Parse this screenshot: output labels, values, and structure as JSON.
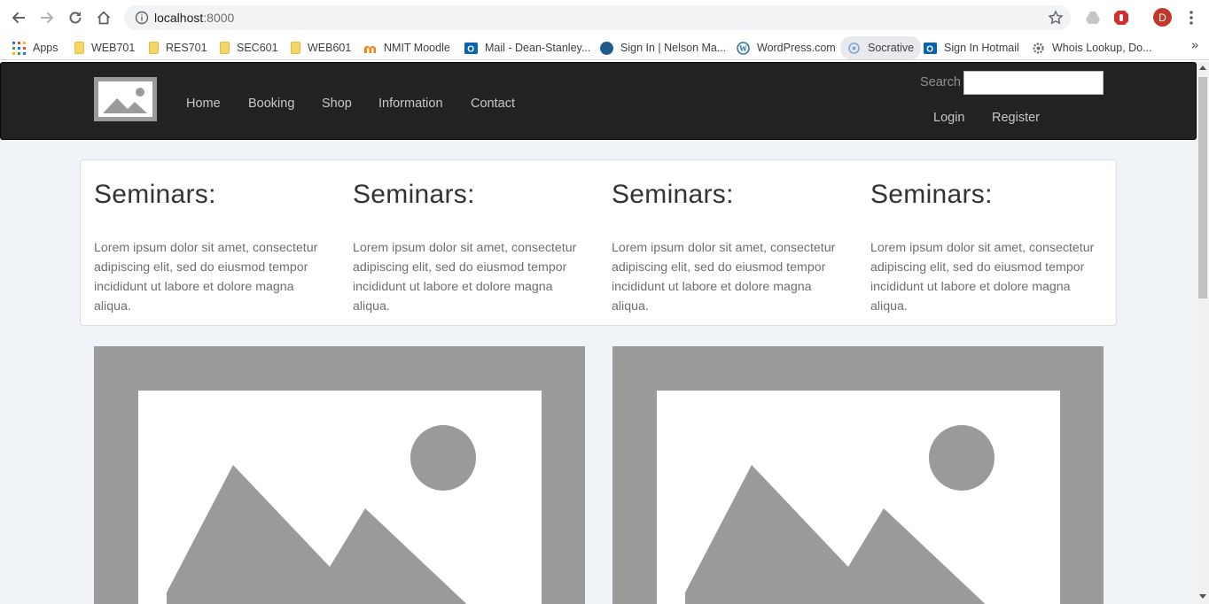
{
  "browser": {
    "url_host": "localhost",
    "url_port": ":8000",
    "profile_initial": "D",
    "bookmarks": [
      {
        "label": "Apps",
        "icon": "apps-grid-icon"
      },
      {
        "label": "WEB701",
        "icon": "folder-icon"
      },
      {
        "label": "RES701",
        "icon": "folder-icon"
      },
      {
        "label": "SEC601",
        "icon": "folder-icon"
      },
      {
        "label": "WEB601",
        "icon": "folder-icon"
      },
      {
        "label": "NMIT Moodle",
        "icon": "moodle-icon"
      },
      {
        "label": "Mail - Dean-Stanley...",
        "icon": "outlook-icon"
      },
      {
        "label": "Sign In | Nelson Ma...",
        "icon": "site-icon"
      },
      {
        "label": "WordPress.com",
        "icon": "wordpress-icon"
      },
      {
        "label": "Socrative",
        "icon": "socrative-icon"
      },
      {
        "label": "Sign In Hotmail",
        "icon": "outlook-icon"
      },
      {
        "label": "Whois Lookup, Do...",
        "icon": "gear-icon"
      }
    ],
    "more_label": "»"
  },
  "navbar": {
    "items": [
      "Home",
      "Booking",
      "Shop",
      "Information",
      "Contact"
    ],
    "search_label": "Search",
    "search_value": "",
    "login_label": "Login",
    "register_label": "Register"
  },
  "seminars": [
    {
      "title": "Seminars:",
      "body": "Lorem ipsum dolor sit amet, consectetur adipiscing elit, sed do eiusmod tempor incididunt ut labore et dolore magna aliqua."
    },
    {
      "title": "Seminars:",
      "body": "Lorem ipsum dolor sit amet, consectetur adipiscing elit, sed do eiusmod tempor incididunt ut labore et dolore magna aliqua."
    },
    {
      "title": "Seminars:",
      "body": "Lorem ipsum dolor sit amet, consectetur adipiscing elit, sed do eiusmod tempor incididunt ut labore et dolore magna aliqua."
    },
    {
      "title": "Seminars:",
      "body": "Lorem ipsum dolor sit amet, consectetur adipiscing elit, sed do eiusmod tempor incididunt ut labore et dolore magna aliqua."
    }
  ],
  "colors": {
    "navbar_bg": "#222222",
    "placeholder_gray": "#9a9a9a",
    "page_bg": "#f0f3f7"
  }
}
